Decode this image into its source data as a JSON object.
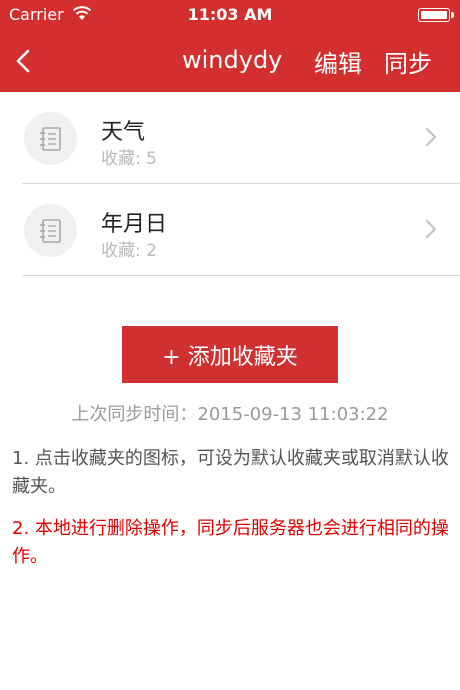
{
  "status_bar": {
    "carrier": "Carrier",
    "time": "11:03 AM"
  },
  "nav": {
    "title": "windydy",
    "edit_label": "编辑",
    "sync_label": "同步",
    "back_icon": "chevron-left-icon"
  },
  "favorites": [
    {
      "name": "天气",
      "count_text": "收藏: 5",
      "icon": "notebook-icon"
    },
    {
      "name": "年月日",
      "count_text": "收藏: 2",
      "icon": "notebook-icon"
    }
  ],
  "add_button_label": "+ 添加收藏夹",
  "last_sync_text": "上次同步时间：2015-09-13 11:03:22",
  "notes": [
    "1. 点击收藏夹的图标，可设为默认收藏夹或取消默认收藏夹。",
    "2. 本地进行删除操作，同步后服务器也会进行相同的操作。"
  ],
  "colors": {
    "brand": "#d42f2f",
    "warning_text": "#e10000"
  }
}
